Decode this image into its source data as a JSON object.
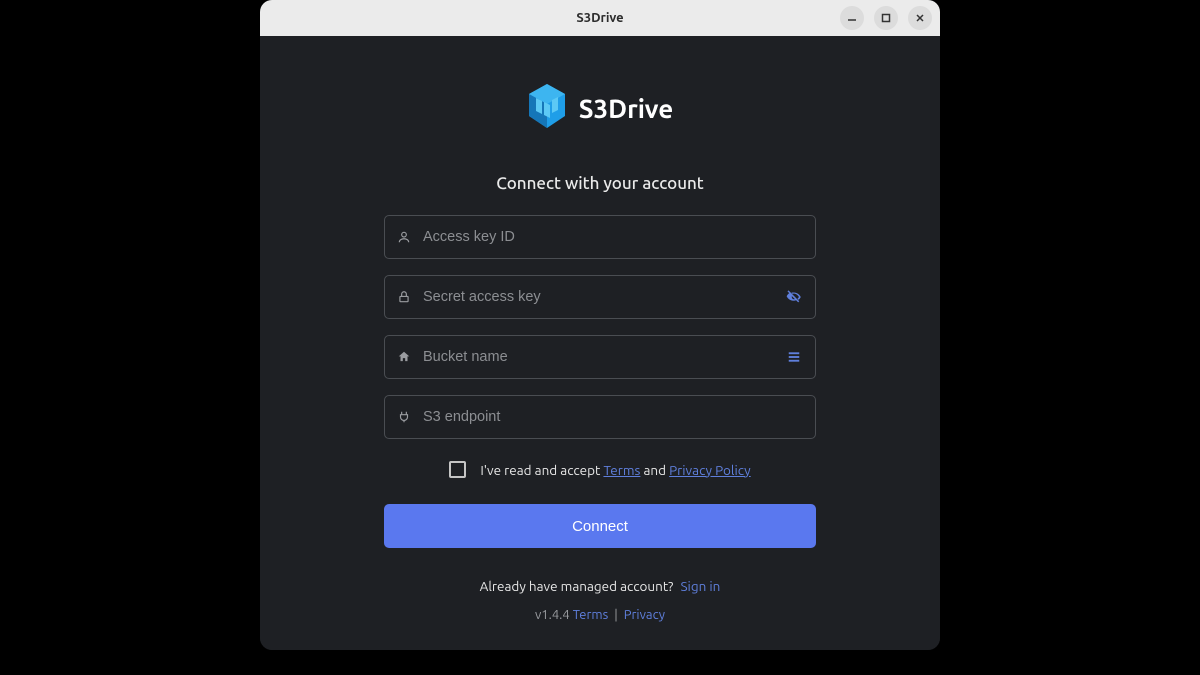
{
  "window": {
    "title": "S3Drive"
  },
  "app": {
    "name": "S3Drive"
  },
  "heading": "Connect with your account",
  "fields": {
    "access_key": {
      "placeholder": "Access key ID",
      "value": ""
    },
    "secret_key": {
      "placeholder": "Secret access key",
      "value": ""
    },
    "bucket": {
      "placeholder": "Bucket name",
      "value": ""
    },
    "endpoint": {
      "placeholder": "S3 endpoint",
      "value": ""
    }
  },
  "consent": {
    "prefix": "I've read and accept",
    "terms_label": "Terms",
    "and": "and",
    "privacy_label": "Privacy Policy"
  },
  "connect_label": "Connect",
  "already": {
    "text": "Already have managed account?",
    "signin": "Sign in"
  },
  "footer": {
    "version": "v1.4.4",
    "terms": "Terms",
    "privacy": "Privacy"
  },
  "colors": {
    "accent": "#5a78ef",
    "link": "#5f7fdc",
    "bg": "#1e2024"
  }
}
